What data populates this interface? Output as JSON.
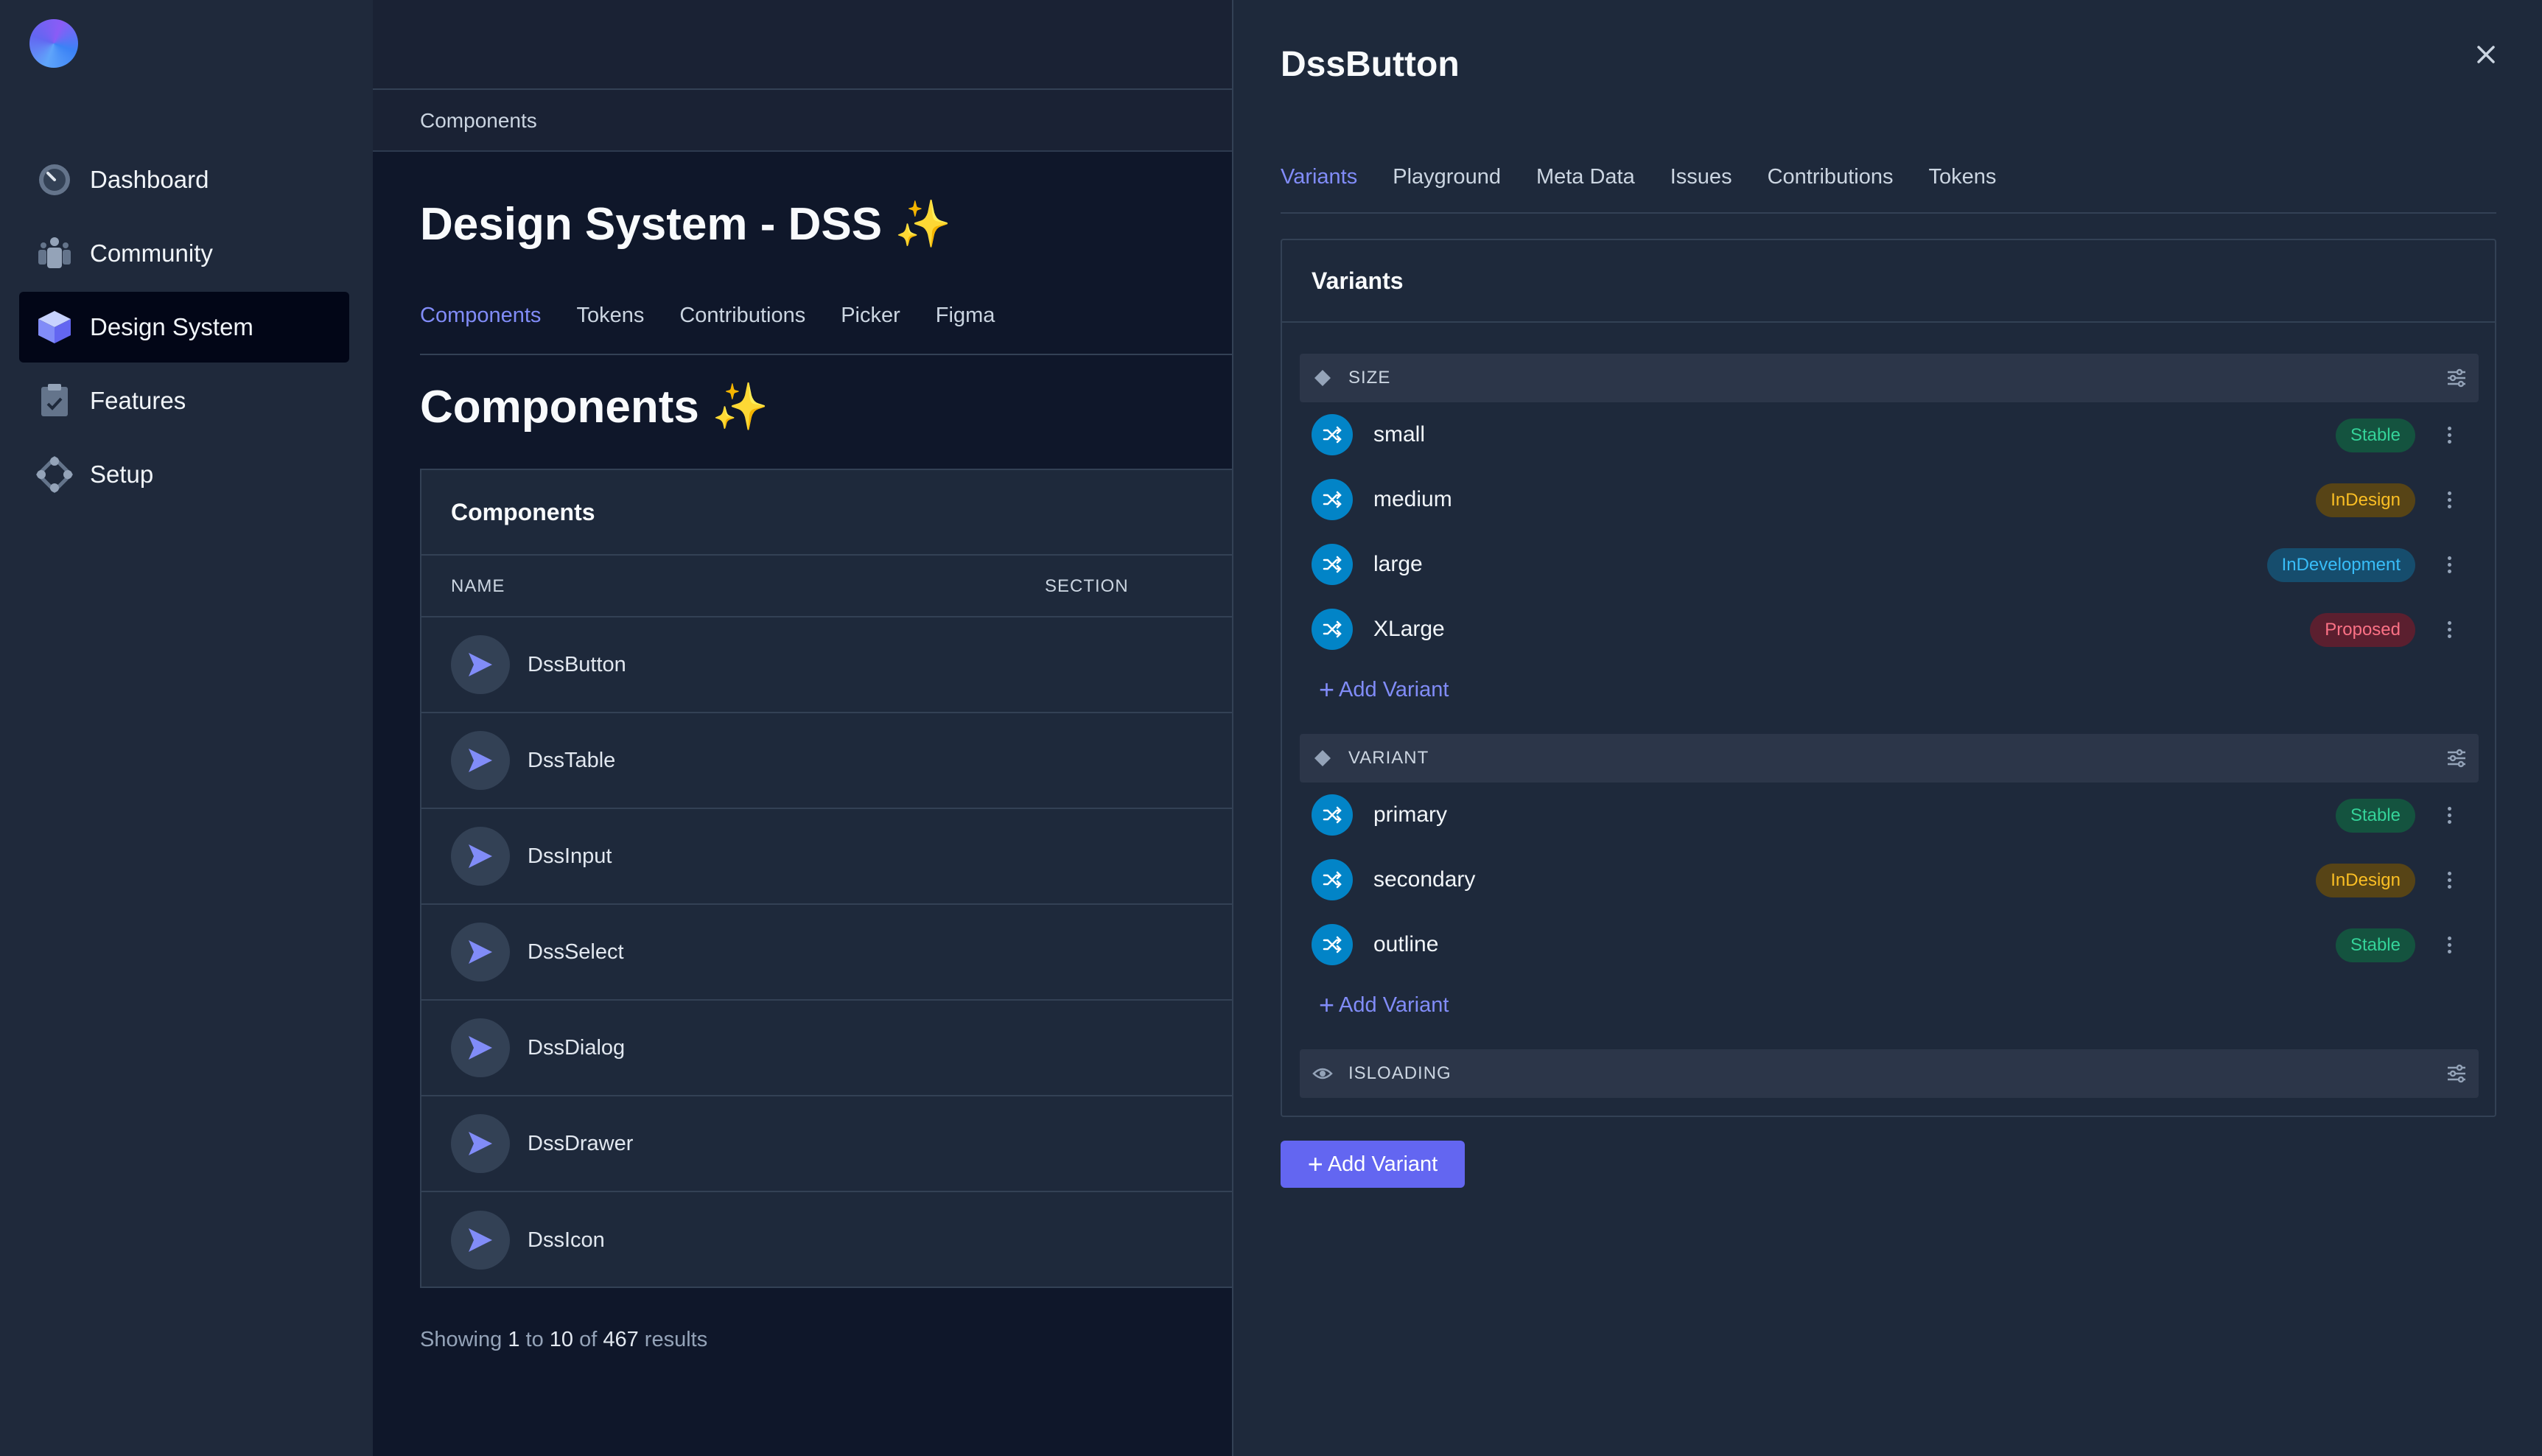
{
  "sidebar": {
    "items": [
      {
        "label": "Dashboard",
        "icon": "dashboard-icon",
        "active": false
      },
      {
        "label": "Community",
        "icon": "community-icon",
        "active": false
      },
      {
        "label": "Design System",
        "icon": "cube-icon",
        "active": true
      },
      {
        "label": "Features",
        "icon": "clipboard-icon",
        "active": false
      },
      {
        "label": "Setup",
        "icon": "setup-icon",
        "active": false
      }
    ]
  },
  "main": {
    "breadcrumb": "Components",
    "title": "Design System - DSS",
    "title_emoji": "✨",
    "tabs": [
      "Components",
      "Tokens",
      "Contributions",
      "Picker",
      "Figma"
    ],
    "active_tab": "Components",
    "section_title": "Components",
    "section_emoji": "✨",
    "card_title": "Components",
    "columns": {
      "name": "NAME",
      "section": "SECTION"
    },
    "components": [
      "DssButton",
      "DssTable",
      "DssInput",
      "DssSelect",
      "DssDialog",
      "DssDrawer",
      "DssIcon"
    ],
    "results": {
      "prefix": "Showing",
      "from": "1",
      "to_word": "to",
      "to": "10",
      "of_word": "of",
      "total": "467",
      "suffix": "results"
    }
  },
  "drawer": {
    "title": "DssButton",
    "tabs": [
      "Variants",
      "Playground",
      "Meta Data",
      "Issues",
      "Contributions",
      "Tokens"
    ],
    "active_tab": "Variants",
    "panel_title": "Variants",
    "groups": [
      {
        "label": "SIZE",
        "icon": "diamond-icon",
        "variants": [
          {
            "name": "small",
            "status": "Stable"
          },
          {
            "name": "medium",
            "status": "InDesign"
          },
          {
            "name": "large",
            "status": "InDevelopment"
          },
          {
            "name": "XLarge",
            "status": "Proposed"
          }
        ],
        "add_label": "Add Variant"
      },
      {
        "label": "VARIANT",
        "icon": "diamond-icon",
        "variants": [
          {
            "name": "primary",
            "status": "Stable"
          },
          {
            "name": "secondary",
            "status": "InDesign"
          },
          {
            "name": "outline",
            "status": "Stable"
          }
        ],
        "add_label": "Add Variant"
      },
      {
        "label": "ISLOADING",
        "icon": "eye-icon",
        "variants": []
      }
    ],
    "add_button": "Add Variant"
  },
  "colors": {
    "accent": "#6366f1",
    "stable": "#34d399",
    "indesign": "#fbbf24",
    "indevelopment": "#38bdf8",
    "proposed": "#fb7185"
  }
}
